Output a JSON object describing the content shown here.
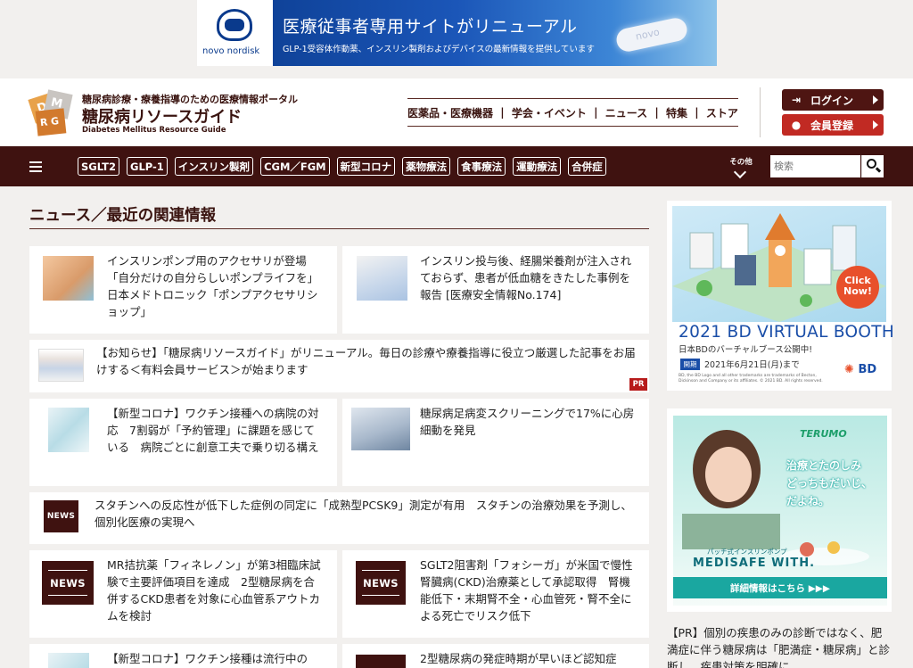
{
  "banner": {
    "brand": "novo nordisk",
    "title": "医療従事者専用サイトがリニューアル",
    "subtitle": "GLP-1受容体作動薬、インスリン製剤およびデバイスの最新情報を提供しています",
    "pill_text": "novo"
  },
  "header": {
    "tagline": "糖尿病診療・療養指導のための医療情報ポータル",
    "title": "糖尿病リソースガイド",
    "title_en": "Diabetes Mellitus Resource Guide",
    "logo_letters": [
      "D",
      "M",
      "R",
      "G"
    ],
    "nav": [
      "医薬品・医療機器",
      "学会・イベント",
      "ニュース",
      "特集",
      "ストア"
    ],
    "nav_sep": "|",
    "login_label": "ログイン",
    "register_label": "会員登録"
  },
  "navbar": {
    "tags": [
      "SGLT2",
      "GLP-1",
      "インスリン製剤",
      "CGM／FGM",
      "新型コロナ",
      "薬物療法",
      "食事療法",
      "運動療法",
      "合併症"
    ],
    "more_label": "その他",
    "search_placeholder": "検索"
  },
  "news": {
    "heading": "ニュース／最近の関連情報",
    "news_label": "NEWS",
    "pr_label": "PR",
    "items": [
      "インスリンポンプ用のアクセサリが登場　「自分だけの自分らしいポンプライフを」　日本メドトロニック「ポンプアクセサリショップ」",
      "インスリン投与後、経腸栄養剤が注入されておらず、患者が低血糖をきたした事例を報告 [医療安全情報No.174]",
      "【お知らせ】「糖尿病リソースガイド」がリニューアル。毎日の診療や療養指導に役立つ厳選した記事をお届けする＜有料会員サービス＞が始まります",
      "【新型コロナ】ワクチン接種への病院の対応　7割弱が「予約管理」に課題を感じている　病院ごとに創意工夫で乗り切る構え",
      "糖尿病足病変スクリーニングで17%に心房細動を発見",
      "スタチンへの反応性が低下した症例の同定に「成熟型PCSK9」測定が有用　スタチンの治療効果を予測し、個別化医療の実現へ",
      "MR拮抗薬「フィネレノン」が第3相臨床試験で主要評価項目を達成　2型糖尿病を合併するCKD患者を対象に心血管系アウトカムを検討",
      "SGLT2阻害剤「フォシーガ」が米国で慢性腎臓病(CKD)治療薬として承認取得　腎機能低下・末期腎不全・心血管死・腎不全による死亡でリスク低下",
      "【新型コロナ】ワクチン接種は流行中の",
      "2型糖尿病の発症時期が早いほど認知症"
    ]
  },
  "sidebar": {
    "ad1": {
      "click_now": "Click Now!",
      "title": "2021 BD VIRTUAL BOOTH",
      "subtitle": "日本BDのバーチャルブース公開中!",
      "date_label": "開期",
      "date": "2021年6月21日(月)まで",
      "fine_print": "BD, the BD Logo and all other trademarks are trademarks of Becton, Dickinson and Company or its affiliates. © 2021 BD. All rights reserved.",
      "logo": "BD"
    },
    "ad2": {
      "brand": "TERUMO",
      "copy_lines": [
        "治療とたのしみ",
        "どっちもだいじ、",
        "だよね。"
      ],
      "product_sub": "パッチ式インスリンポンプ",
      "product": "MEDISAFE WITH.",
      "button": "詳細情報はこちら ▶▶▶"
    },
    "pr_text": "【PR】個別の疾患のみの診断ではなく、肥満症に伴う糖尿病は「肥満症・糖尿病」と診断し、疾患対策を明確に"
  },
  "colors": {
    "brand_dark": "#3f1210",
    "register_red": "#c12a23",
    "bd_blue": "#1a4ea8",
    "terumo_teal": "#1aa7a0"
  }
}
